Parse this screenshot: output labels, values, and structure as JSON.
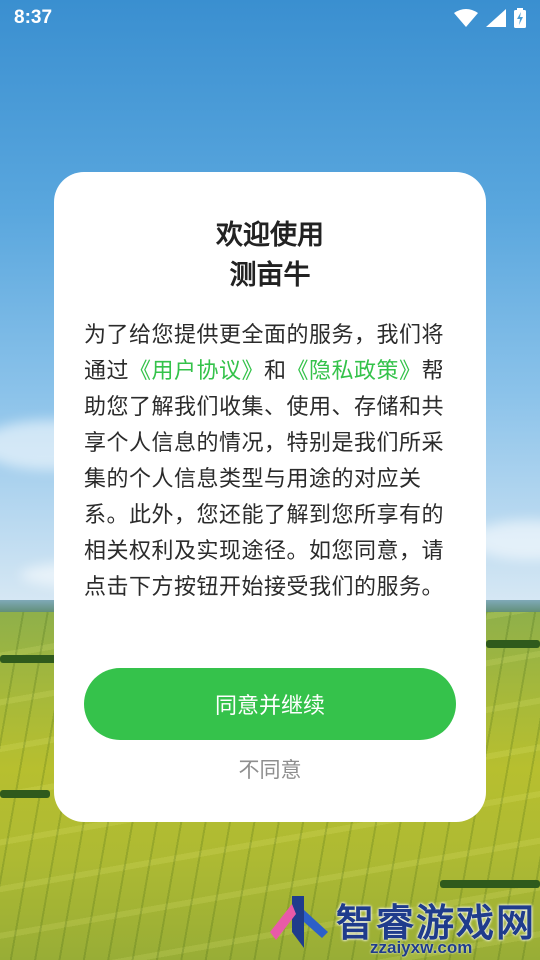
{
  "status_bar": {
    "time": "8:37",
    "icons": [
      "wifi-icon",
      "signal-icon",
      "battery-charging-icon"
    ]
  },
  "dialog": {
    "title_line1": "欢迎使用",
    "title_line2": "测亩牛",
    "body": {
      "p1": "为了给您提供更全面的服务，我们将通过",
      "link_user_agreement": "《用户协议》",
      "p2": "和",
      "link_privacy_policy": "《隐私政策》",
      "p3": "帮助您了解我们收集、使用、存储和共享个人信息的情况，特别是我们所采集的个人信息类型与用途的对应关系。此外，您还能了解到您所享有的相关权利及实现途径。如您同意，请点击下方按钮开始接受我们的服务。"
    },
    "agree_button": "同意并继续",
    "disagree_button": "不同意"
  },
  "watermark": {
    "name": "智睿游戏网",
    "url": "zzaiyxw.com"
  },
  "colors": {
    "accent": "#35c24b",
    "link": "#34c24a",
    "muted": "#8e8e8e",
    "watermark": "#1f3c8c"
  }
}
